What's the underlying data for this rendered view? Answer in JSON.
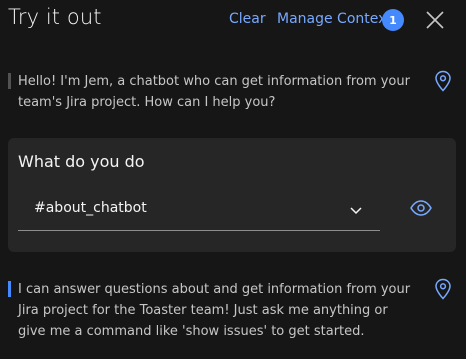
{
  "header": {
    "title": "Try it out",
    "clear_label": "Clear",
    "manage_context_label": "Manage Context",
    "context_count": "1"
  },
  "messages": [
    {
      "text": "Hello! I'm Jem, a chatbot who can get information from your team's Jira project. How can I help you?",
      "accent": "#525252"
    },
    {
      "text": "I can answer questions about and get information from your Jira project for the Toaster team! Just ask me anything or give me a command like 'show issues' to get started.",
      "accent": "#4589ff"
    }
  ],
  "intent_card": {
    "label": "What do you do",
    "selected_value": "#about_chatbot"
  },
  "icons": {
    "pin": "location-pin-icon",
    "eye": "view-eye-icon",
    "close": "close-icon",
    "chevron": "chevron-down-icon"
  },
  "colors": {
    "background": "#161616",
    "card": "#262626",
    "link": "#78a9ff",
    "badge": "#4589ff",
    "text": "#f4f4f4",
    "muted_text": "#c6c6c6"
  }
}
